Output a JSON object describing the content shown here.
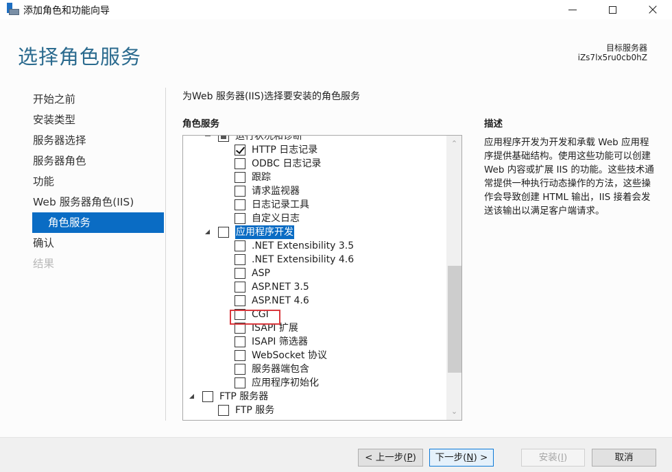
{
  "window": {
    "title": "添加角色和功能向导",
    "controls": {
      "minimize": "minimize",
      "maximize": "maximize",
      "close": "×"
    }
  },
  "header": {
    "page_title": "选择角色服务",
    "target_server_label": "目标服务器",
    "target_server_value": "iZs7lx5ru0cb0hZ"
  },
  "nav": {
    "items": [
      {
        "label": "开始之前",
        "state": "normal"
      },
      {
        "label": "安装类型",
        "state": "normal"
      },
      {
        "label": "服务器选择",
        "state": "normal"
      },
      {
        "label": "服务器角色",
        "state": "normal"
      },
      {
        "label": "功能",
        "state": "normal"
      },
      {
        "label": "Web 服务器角色(IIS)",
        "state": "normal"
      },
      {
        "label": "角色服务",
        "state": "active"
      },
      {
        "label": "确认",
        "state": "normal"
      },
      {
        "label": "结果",
        "state": "disabled"
      }
    ]
  },
  "main": {
    "subtitle": "为Web 服务器(IIS)选择要安装的角色服务",
    "roles_heading": "角色服务",
    "tree": [
      {
        "label": "运行状况和诊断",
        "level": 1,
        "checked": "partial",
        "expander": "expanded-cut"
      },
      {
        "label": "HTTP 日志记录",
        "level": 2,
        "checked": true
      },
      {
        "label": "ODBC 日志记录",
        "level": 2,
        "checked": false
      },
      {
        "label": "跟踪",
        "level": 2,
        "checked": false
      },
      {
        "label": "请求监视器",
        "level": 2,
        "checked": false
      },
      {
        "label": "日志记录工具",
        "level": 2,
        "checked": false
      },
      {
        "label": "自定义日志",
        "level": 2,
        "checked": false
      },
      {
        "label": "应用程序开发",
        "level": 1,
        "checked": false,
        "expander": "expanded",
        "selected": true
      },
      {
        "label": ".NET Extensibility 3.5",
        "level": 2,
        "checked": false
      },
      {
        "label": ".NET Extensibility 4.6",
        "level": 2,
        "checked": false
      },
      {
        "label": "ASP",
        "level": 2,
        "checked": false
      },
      {
        "label": "ASP.NET 3.5",
        "level": 2,
        "checked": false
      },
      {
        "label": "ASP.NET 4.6",
        "level": 2,
        "checked": false
      },
      {
        "label": "CGI",
        "level": 2,
        "checked": false,
        "highlighted": true
      },
      {
        "label": "ISAPI 扩展",
        "level": 2,
        "checked": false
      },
      {
        "label": "ISAPI 筛选器",
        "level": 2,
        "checked": false
      },
      {
        "label": "WebSocket 协议",
        "level": 2,
        "checked": false
      },
      {
        "label": "服务器端包含",
        "level": 2,
        "checked": false
      },
      {
        "label": "应用程序初始化",
        "level": 2,
        "checked": false
      },
      {
        "label": "FTP 服务器",
        "level": 0,
        "checked": false,
        "expander": "expanded"
      },
      {
        "label": "FTP 服务",
        "level": 1,
        "checked": false
      }
    ],
    "scrollbar": {
      "up": "⌃",
      "down": "⌄",
      "position_fraction": 0.5
    }
  },
  "description": {
    "heading": "描述",
    "text": "应用程序开发为开发和承载 Web 应用程序提供基础结构。使用这些功能可以创建 Web 内容或扩展 IIS 的功能。这些技术通常提供一种执行动态操作的方法，这些操作会导致创建 HTML 输出，IIS 接着会发送该输出以满足客户端请求。"
  },
  "footer": {
    "prev": {
      "prefix": "< 上一步(",
      "key": "P",
      "suffix": ")"
    },
    "next": {
      "prefix": "下一步(",
      "key": "N",
      "suffix": ") >"
    },
    "install": {
      "prefix": "安装(",
      "key": "I",
      "suffix": ")"
    },
    "cancel": "取消"
  }
}
